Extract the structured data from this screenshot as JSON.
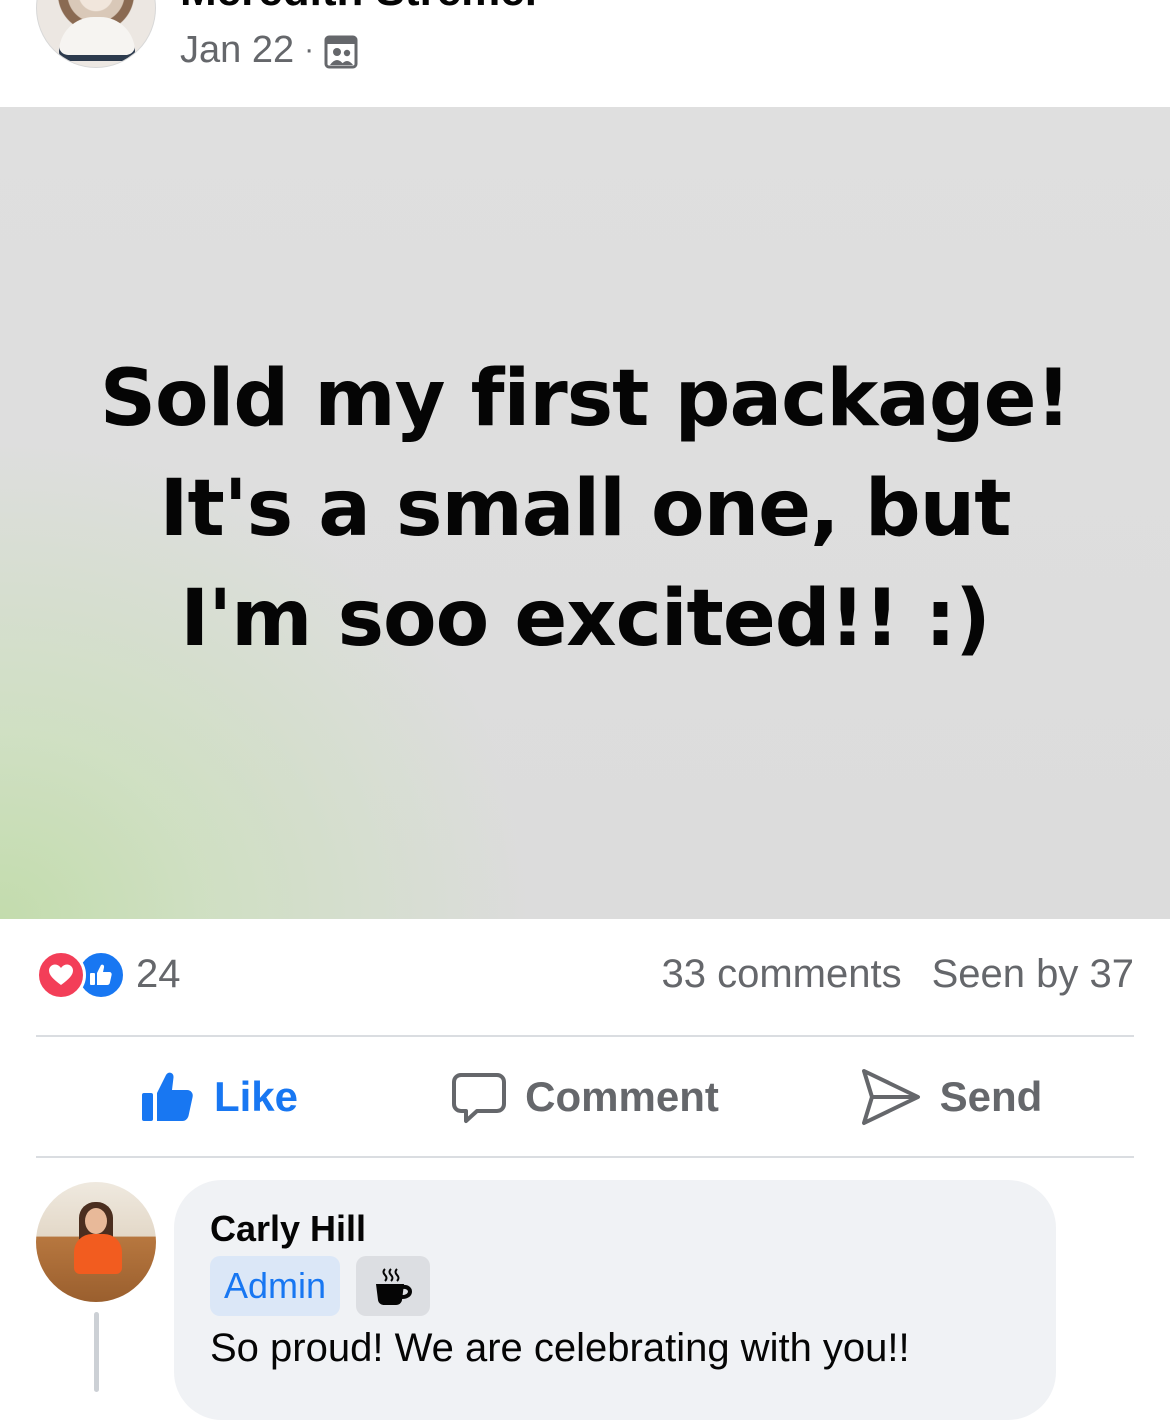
{
  "post": {
    "author_name": "Meredith Stremel",
    "date": "Jan 22",
    "separator": "·",
    "visibility_icon": "group-members-icon",
    "text_lines": [
      "Sold my first package!",
      "It's a small one, but",
      "I'm soo excited!! :)"
    ],
    "background": {
      "base_color": "#dcdcdc",
      "accent_color": "#c3dcad"
    }
  },
  "summary": {
    "reaction_icons": [
      "love-reaction-icon",
      "like-reaction-icon"
    ],
    "reaction_count": "24",
    "comments": "33 comments",
    "seen_by": "Seen by 37"
  },
  "actions": {
    "like_label": "Like",
    "comment_label": "Comment",
    "send_label": "Send",
    "like_color": "#1877f2",
    "muted_color": "#65676b"
  },
  "comment": {
    "author_name": "Carly Hill",
    "badge_label": "Admin",
    "badge_icon": "coffee-cup-icon",
    "text": "So proud! We are celebrating with you!!"
  }
}
